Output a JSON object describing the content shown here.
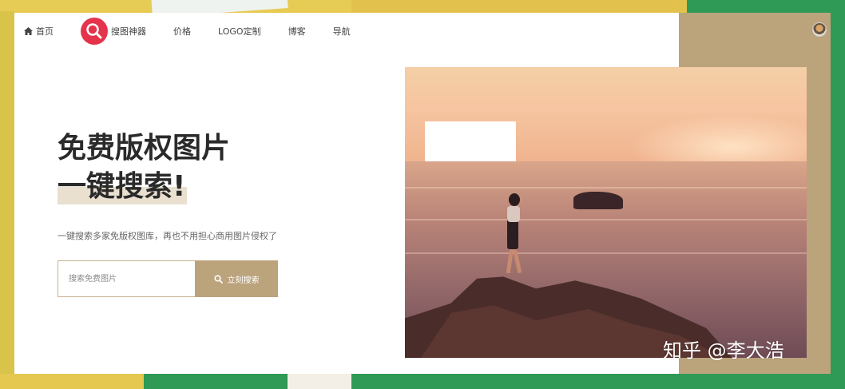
{
  "nav": {
    "home": "首页",
    "logo_label": "搜图神器",
    "price": "价格",
    "logo_custom": "LOGO定制",
    "blog": "博客",
    "navigation": "导航"
  },
  "hero": {
    "title_line1": "免费版权图片",
    "title_line2": "一键搜索!",
    "subtitle": "一键搜索多家免版权图库，再也不用担心商用图片侵权了"
  },
  "search": {
    "placeholder": "搜索免费图片",
    "button_label": "立刻搜索"
  },
  "watermark": "知乎 @李大浩",
  "colors": {
    "accent": "#bba37c",
    "logo_red": "#e5334b",
    "panel": "#ffffff"
  },
  "icons": {
    "home": "house-icon",
    "logo": "magnifier-icon",
    "search": "search-icon",
    "avatar": "avatar"
  }
}
